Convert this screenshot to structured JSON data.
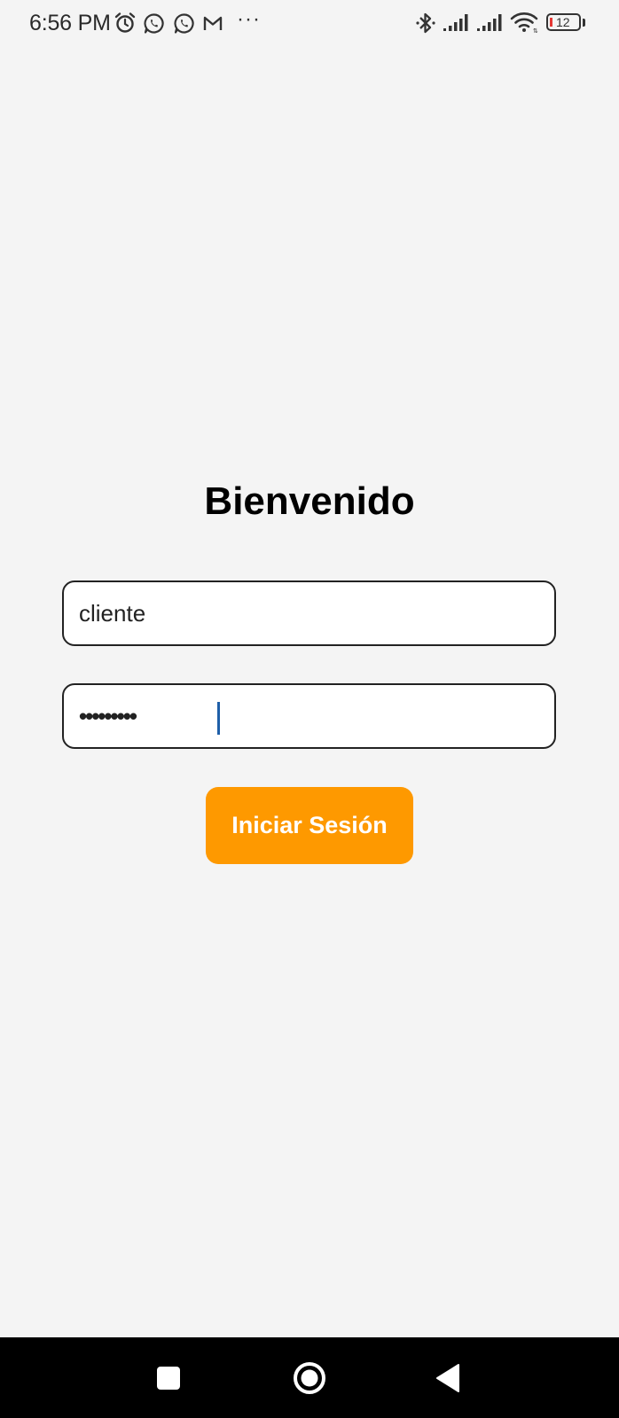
{
  "status_bar": {
    "time": "6:56 PM",
    "more_indicator": "···",
    "battery_level": "12",
    "notification_icons": [
      "alarm-icon",
      "whatsapp-icon",
      "whatsapp-icon",
      "gmail-icon"
    ],
    "system_icons": [
      "bluetooth-icon",
      "cellular-signal-icon",
      "cellular-signal-icon",
      "wifi-icon",
      "battery-icon"
    ]
  },
  "login": {
    "title": "Bienvenido",
    "username_value": "cliente",
    "password_masked": "•••••••••",
    "submit_label": "Iniciar Sesión"
  },
  "navigation": {
    "buttons": [
      "recent-apps-icon",
      "home-icon",
      "back-icon"
    ]
  },
  "colors": {
    "background": "#f4f4f4",
    "accent": "#fe9900",
    "cursor": "#1f5fa8",
    "nav_bar": "#000000",
    "battery_low": "#e53935"
  }
}
